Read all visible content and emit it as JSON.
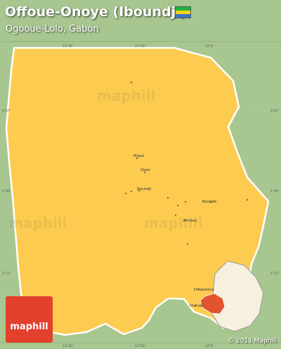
{
  "map": {
    "title": "Offoue-Onoye (Iboundji)",
    "subtitle": "Ogooue-Lolo, Gabon",
    "copyright": "© 2011 Maphill",
    "logo_text": "maphill",
    "watermark_text": "maphill",
    "flag_colors": [
      "#1eb53a",
      "#fcd116",
      "#3a75c4"
    ],
    "colors": {
      "outside": "#a7c690",
      "region": "#fdcb4f",
      "region_border": "#ffffff",
      "highlight": "#e2542f",
      "logo": "#e3402d"
    },
    "places": [
      {
        "name": "Mipyé"
      },
      {
        "name": "Ossei"
      },
      {
        "name": "Iboundji"
      },
      {
        "name": "Bouladé"
      },
      {
        "name": "Dimbou"
      },
      {
        "name": "Doupoaoua"
      },
      {
        "name": "Divindé"
      }
    ],
    "graticule": {
      "top": [
        "11°30'",
        "11°50'",
        "12°0'"
      ],
      "bottom": [
        "11°30'",
        "11°50'",
        "12°0'"
      ],
      "left": [
        "0°47'",
        "1°00'",
        "1°12'"
      ],
      "right": [
        "0°47'",
        "1°00'",
        "1°12'"
      ]
    }
  }
}
